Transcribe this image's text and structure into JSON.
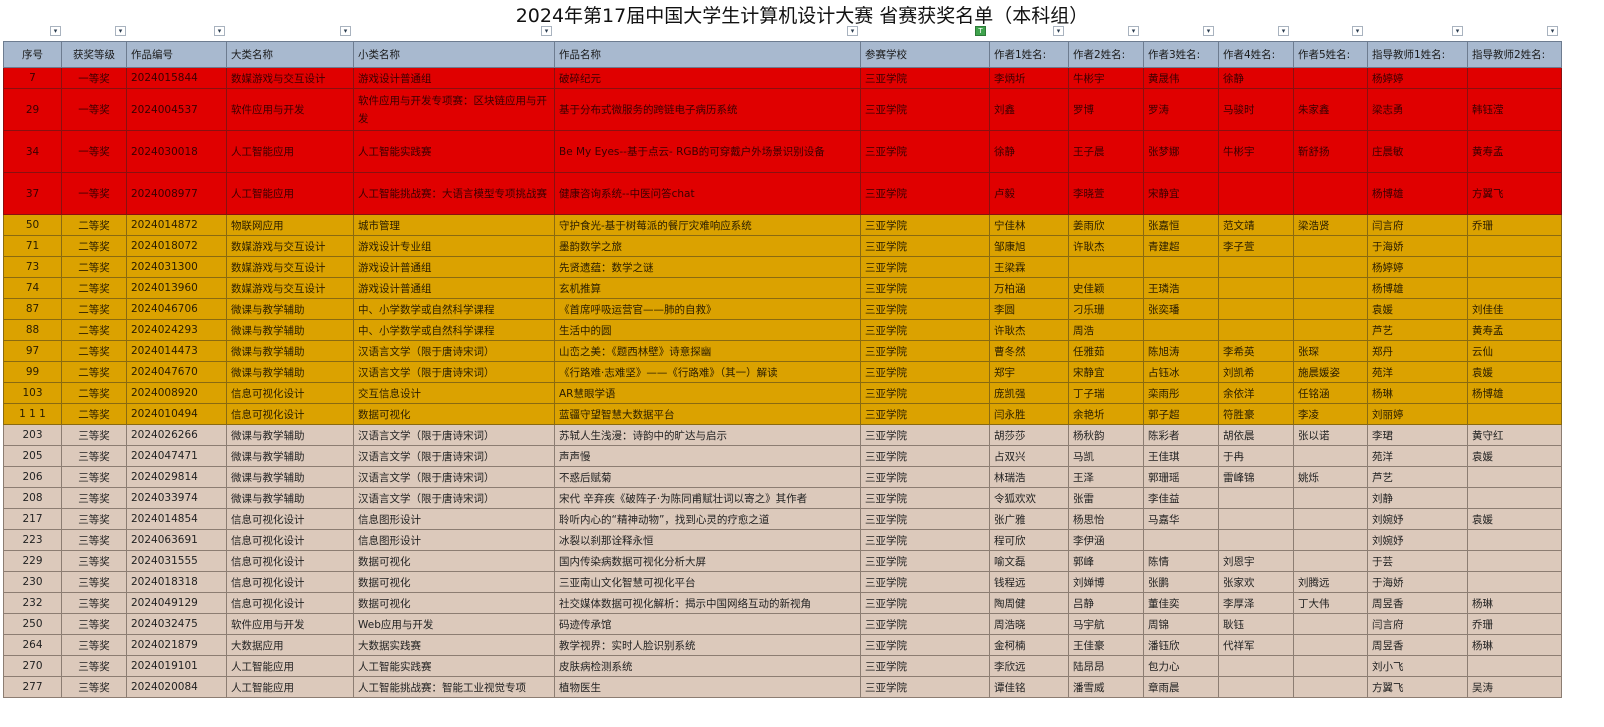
{
  "title": "2024年第17届中国大学生计算机设计大赛 省赛获奖名单（本科组）",
  "headers": [
    "序号",
    "获奖等级",
    "作品编号",
    "大类名称",
    "小类名称",
    "作品名称",
    "参赛学校",
    "作者1姓名:",
    "作者2姓名:",
    "作者3姓名:",
    "作者4姓名:",
    "作者5姓名:",
    "指导教师1姓名:",
    "指导教师2姓名:"
  ],
  "rows": [
    {
      "tier": "t1",
      "tall": false,
      "cells": [
        "7",
        "一等奖",
        "2024015844",
        "数媒游戏与交互设计",
        "游戏设计普通组",
        "破碎纪元",
        "三亚学院",
        "李炳圻",
        "牛彬宇",
        "黄晟伟",
        "徐静",
        "",
        "杨婷婷",
        ""
      ]
    },
    {
      "tier": "t1",
      "tall": true,
      "cells": [
        "29",
        "一等奖",
        "2024004537",
        "软件应用与开发",
        "软件应用与开发专项赛：区块链应用与开发",
        "基于分布式微服务的跨链电子病历系统",
        "三亚学院",
        "刘鑫",
        "罗博",
        "罗涛",
        "马骏时",
        "朱家鑫",
        "梁志勇",
        "韩钰滢"
      ]
    },
    {
      "tier": "t1",
      "tall": true,
      "cells": [
        "34",
        "一等奖",
        "2024030018",
        "人工智能应用",
        "人工智能实践赛",
        "Be My Eyes--基于点云- RGB的可穿戴户外场景识别设备",
        "三亚学院",
        "徐静",
        "王子晨",
        "张梦娜",
        "牛彬宇",
        "靳舒扬",
        "庄晨敏",
        "黄寿孟"
      ]
    },
    {
      "tier": "t1",
      "tall": true,
      "cells": [
        "37",
        "一等奖",
        "2024008977",
        "人工智能应用",
        "人工智能挑战赛：大语言模型专项挑战赛",
        "健康咨询系统--中医问答chat",
        "三亚学院",
        "卢毅",
        "李晓萱",
        "宋静宜",
        "",
        "",
        "杨博雄",
        "方翼飞"
      ]
    },
    {
      "tier": "t2",
      "tall": false,
      "cells": [
        "50",
        "二等奖",
        "2024014872",
        "物联网应用",
        "城市管理",
        "守护食光-基于树莓派的餐厅灾难响应系统",
        "三亚学院",
        "宁佳林",
        "姜雨欣",
        "张嘉恒",
        "范文靖",
        "梁浩贤",
        "闫言府",
        "乔珊"
      ]
    },
    {
      "tier": "t2",
      "tall": false,
      "cells": [
        "71",
        "二等奖",
        "2024018072",
        "数媒游戏与交互设计",
        "游戏设计专业组",
        "墨韵数学之旅",
        "三亚学院",
        "邹康旭",
        "许耿杰",
        "青建超",
        "李子萱",
        "",
        "于海娇",
        ""
      ]
    },
    {
      "tier": "t2",
      "tall": false,
      "cells": [
        "73",
        "二等奖",
        "2024031300",
        "数媒游戏与交互设计",
        "游戏设计普通组",
        "先贤遗蕴：数学之谜",
        "三亚学院",
        "王梁霖",
        "",
        "",
        "",
        "",
        "杨婷婷",
        ""
      ]
    },
    {
      "tier": "t2",
      "tall": false,
      "cells": [
        "74",
        "二等奖",
        "2024013960",
        "数媒游戏与交互设计",
        "游戏设计普通组",
        "玄机推算",
        "三亚学院",
        "万柏涵",
        "史佳颖",
        "王璘浩",
        "",
        "",
        "杨博雄",
        ""
      ]
    },
    {
      "tier": "t2",
      "tall": false,
      "cells": [
        "87",
        "二等奖",
        "2024046706",
        "微课与教学辅助",
        "中、小学数学或自然科学课程",
        "《首席呼吸运营官——肺的自救》",
        "三亚学院",
        "李圆",
        "刁乐珊",
        "张奕璠",
        "",
        "",
        "袁媛",
        "刘佳佳"
      ]
    },
    {
      "tier": "t2",
      "tall": false,
      "cells": [
        "88",
        "二等奖",
        "2024024293",
        "微课与教学辅助",
        "中、小学数学或自然科学课程",
        "生活中的圆",
        "三亚学院",
        "许耿杰",
        "周浩",
        "",
        "",
        "",
        "芦艺",
        "黄寿孟"
      ]
    },
    {
      "tier": "t2",
      "tall": false,
      "cells": [
        "97",
        "二等奖",
        "2024014473",
        "微课与教学辅助",
        "汉语言文学（限于唐诗宋词）",
        "山峦之美：《题西林壁》诗意探幽",
        "三亚学院",
        "曹冬然",
        "任雅茹",
        "陈旭涛",
        "李希英",
        "张琛",
        "郑丹",
        "云仙"
      ]
    },
    {
      "tier": "t2",
      "tall": false,
      "cells": [
        "99",
        "二等奖",
        "2024047670",
        "微课与教学辅助",
        "汉语言文学（限于唐诗宋词）",
        "《行路难·志难坚》——《行路难》（其一）解读",
        "三亚学院",
        "郑宇",
        "宋静宜",
        "占钰冰",
        "刘凯希",
        "施晨媛姿",
        "苑洋",
        "袁媛"
      ]
    },
    {
      "tier": "t2",
      "tall": false,
      "cells": [
        "103",
        "二等奖",
        "2024008920",
        "信息可视化设计",
        "交互信息设计",
        "AR慧眼学语",
        "三亚学院",
        "庞凯强",
        "丁子瑞",
        "栾雨彤",
        "余依洋",
        "任铭涵",
        "杨琳",
        "杨博雄"
      ]
    },
    {
      "tier": "t2",
      "tall": false,
      "cells": [
        "1 1 1",
        "二等奖",
        "2024010494",
        "信息可视化设计",
        "数据可视化",
        "蓝疆守望智慧大数据平台",
        "三亚学院",
        "闫永胜",
        "余艳圻",
        "郭子超",
        "符胜豪",
        "李凌",
        "刘丽婷",
        ""
      ]
    },
    {
      "tier": "t3",
      "tall": false,
      "cells": [
        "203",
        "三等奖",
        "2024026266",
        "微课与教学辅助",
        "汉语言文学（限于唐诗宋词）",
        "苏轼人生浅漫：诗韵中的旷达与启示",
        "三亚学院",
        "胡莎莎",
        "杨秋韵",
        "陈彩者",
        "胡依晨",
        "张以诺",
        "李珺",
        "黄守红"
      ]
    },
    {
      "tier": "t3",
      "tall": false,
      "cells": [
        "205",
        "三等奖",
        "2024047471",
        "微课与教学辅助",
        "汉语言文学（限于唐诗宋词）",
        "声声慢",
        "三亚学院",
        "占双兴",
        "马凯",
        "王佳琪",
        "于冉",
        "",
        "苑洋",
        "袁媛"
      ]
    },
    {
      "tier": "t3",
      "tall": false,
      "cells": [
        "206",
        "三等奖",
        "2024029814",
        "微课与教学辅助",
        "汉语言文学（限于唐诗宋词）",
        "不惑后赋菊",
        "三亚学院",
        "林瑞浩",
        "王泽",
        "郭珊瑶",
        "雷峰锦",
        "姚烁",
        "芦艺",
        ""
      ]
    },
    {
      "tier": "t3",
      "tall": false,
      "cells": [
        "208",
        "三等奖",
        "2024033974",
        "微课与教学辅助",
        "汉语言文学（限于唐诗宋词）",
        "宋代 辛弃疾《破阵子·为陈同甫赋壮词以寄之》其作者",
        "三亚学院",
        "令狐欢欢",
        "张雷",
        "李佳益",
        "",
        "",
        "刘静",
        ""
      ]
    },
    {
      "tier": "t3",
      "tall": false,
      "cells": [
        "217",
        "三等奖",
        "2024014854",
        "信息可视化设计",
        "信息图形设计",
        "聆听内心的“精神动物”，找到心灵的疗愈之道",
        "三亚学院",
        "张广雅",
        "杨思怡",
        "马嘉华",
        "",
        "",
        "刘婉妤",
        "袁媛"
      ]
    },
    {
      "tier": "t3",
      "tall": false,
      "cells": [
        "223",
        "三等奖",
        "2024063691",
        "信息可视化设计",
        "信息图形设计",
        "冰裂以刹那诠释永恒",
        "三亚学院",
        "程可欣",
        "李伊涵",
        "",
        "",
        "",
        "刘婉妤",
        ""
      ]
    },
    {
      "tier": "t3",
      "tall": false,
      "cells": [
        "229",
        "三等奖",
        "2024031555",
        "信息可视化设计",
        "数据可视化",
        "国内传染病数据可视化分析大屏",
        "三亚学院",
        "喻文磊",
        "郭峰",
        "陈情",
        "刘恩宇",
        "",
        "于芸",
        ""
      ]
    },
    {
      "tier": "t3",
      "tall": false,
      "cells": [
        "230",
        "三等奖",
        "2024018318",
        "信息可视化设计",
        "数据可视化",
        "三亚南山文化智慧可视化平台",
        "三亚学院",
        "钱程远",
        "刘婵博",
        "张鹏",
        "张家欢",
        "刘腾远",
        "于海娇",
        ""
      ]
    },
    {
      "tier": "t3",
      "tall": false,
      "cells": [
        "232",
        "三等奖",
        "2024049129",
        "信息可视化设计",
        "数据可视化",
        "社交媒体数据可视化解析：揭示中国网络互动的新视角",
        "三亚学院",
        "陶周健",
        "吕静",
        "董佳奕",
        "李厚泽",
        "丁大伟",
        "周昱香",
        "杨琳"
      ]
    },
    {
      "tier": "t3",
      "tall": false,
      "cells": [
        "250",
        "三等奖",
        "2024032475",
        "软件应用与开发",
        "Web应用与开发",
        "码迹传承馆",
        "三亚学院",
        "周浩晓",
        "马宇航",
        "周锦",
        "耿钰",
        "",
        "闫言府",
        "乔珊"
      ]
    },
    {
      "tier": "t3",
      "tall": false,
      "cells": [
        "264",
        "三等奖",
        "2024021879",
        "大数据应用",
        "大数据实践赛",
        "教学视界：实时人脸识别系统",
        "三亚学院",
        "金柯楠",
        "王佳豪",
        "潘钰欣",
        "代祥军",
        "",
        "周昱香",
        "杨琳"
      ]
    },
    {
      "tier": "t3",
      "tall": false,
      "cells": [
        "270",
        "三等奖",
        "2024019101",
        "人工智能应用",
        "人工智能实践赛",
        "皮肤病检测系统",
        "三亚学院",
        "李欣远",
        "陆昂昂",
        "包力心",
        "",
        "",
        "刘小飞",
        ""
      ]
    },
    {
      "tier": "t3",
      "tall": false,
      "cells": [
        "277",
        "三等奖",
        "2024020084",
        "人工智能应用",
        "人工智能挑战赛：智能工业视觉专项",
        "植物医生",
        "三亚学院",
        "谭佳铭",
        "潘雪威",
        "章雨晨",
        "",
        "",
        "方翼飞",
        "吴涛"
      ]
    }
  ]
}
